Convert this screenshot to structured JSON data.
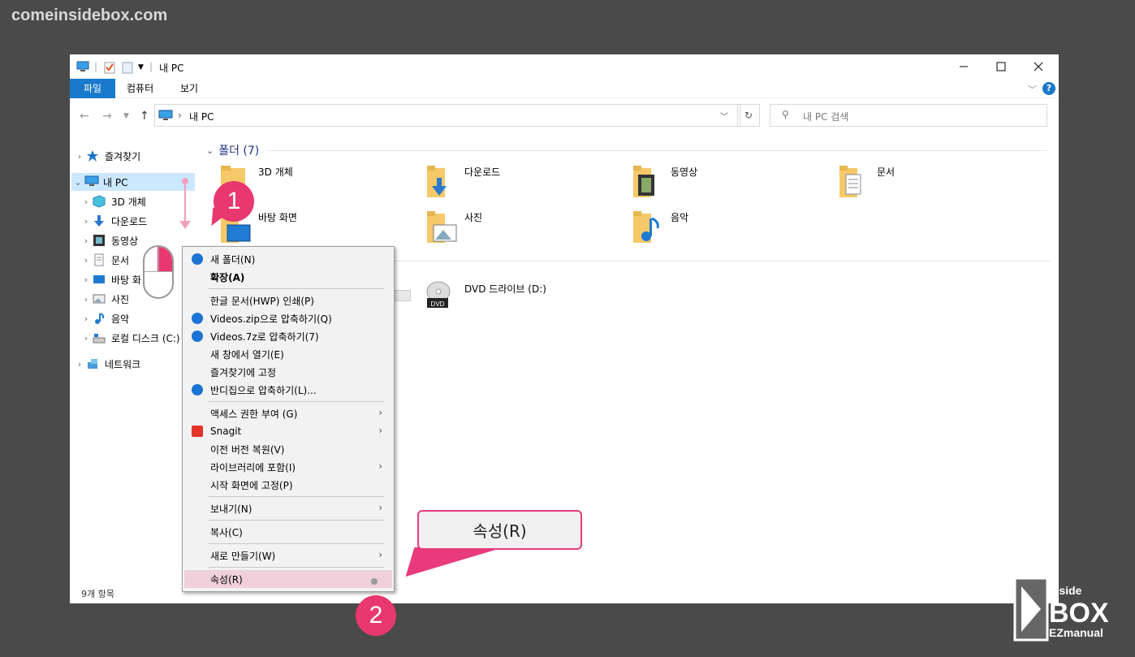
{
  "watermark": "comeinsidebox.com",
  "window": {
    "title": "내 PC",
    "ribbon_tabs": [
      "파일",
      "컴퓨터",
      "보기"
    ],
    "address": "내 PC",
    "search_placeholder": "내 PC 검색",
    "status": "9개 항목"
  },
  "sidebar": {
    "items": [
      {
        "label": "즐겨찾기",
        "icon": "star-icon"
      },
      {
        "label": "내 PC",
        "icon": "computer-icon",
        "selected": true
      },
      {
        "label": "3D 개체",
        "icon": "cube-icon"
      },
      {
        "label": "다운로드",
        "icon": "download-icon"
      },
      {
        "label": "동영상",
        "icon": "video-icon"
      },
      {
        "label": "문서",
        "icon": "document-icon"
      },
      {
        "label": "바탕 화",
        "icon": "desktop-icon"
      },
      {
        "label": "사진",
        "icon": "picture-icon"
      },
      {
        "label": "음악",
        "icon": "music-icon"
      },
      {
        "label": "로컬 디스크 (C:)",
        "icon": "disk-icon"
      },
      {
        "label": "네트워크",
        "icon": "network-icon"
      }
    ]
  },
  "content": {
    "folders_header": "폴더 (7)",
    "folders": [
      {
        "label": "3D 개체"
      },
      {
        "label": "다운로드"
      },
      {
        "label": "동영상"
      },
      {
        "label": "문서"
      },
      {
        "label": "바탕 화면"
      },
      {
        "label": "사진"
      },
      {
        "label": "음악"
      }
    ],
    "drive": {
      "label": "DVD 드라이브 (D:)",
      "badge": "DVD"
    }
  },
  "context_menu": {
    "items": [
      {
        "label": "새 폴더(N)",
        "icon": true
      },
      {
        "label": "확장(A)",
        "bold": true
      },
      {
        "label": "한글 문서(HWP) 인쇄(P)"
      },
      {
        "label": "Videos.zip으로 압축하기(Q)",
        "icon": true
      },
      {
        "label": "Videos.7z로 압축하기(7)",
        "icon": true
      },
      {
        "label": "새 창에서 열기(E)"
      },
      {
        "label": "즐겨찾기에 고정"
      },
      {
        "label": "반디집으로 압축하기(L)...",
        "icon": true
      },
      {
        "label": "액세스 권한 부여 (G)",
        "submenu": true
      },
      {
        "label": "Snagit",
        "submenu": true,
        "snagit": true
      },
      {
        "label": "이전 버전 복원(V)"
      },
      {
        "label": "라이브러리에 포함(I)",
        "submenu": true
      },
      {
        "label": "시작 화면에 고정(P)"
      },
      {
        "label": "보내기(N)",
        "submenu": true
      },
      {
        "label": "복사(C)"
      },
      {
        "label": "새로 만들기(W)",
        "submenu": true
      },
      {
        "label": "속성(R)",
        "highlighted": true
      }
    ]
  },
  "annotations": {
    "callout": "속성(R)",
    "badge1": "1",
    "badge2": "2"
  },
  "brand": {
    "line1": "inside",
    "line2": "BOX",
    "line3": "EZmanual"
  }
}
